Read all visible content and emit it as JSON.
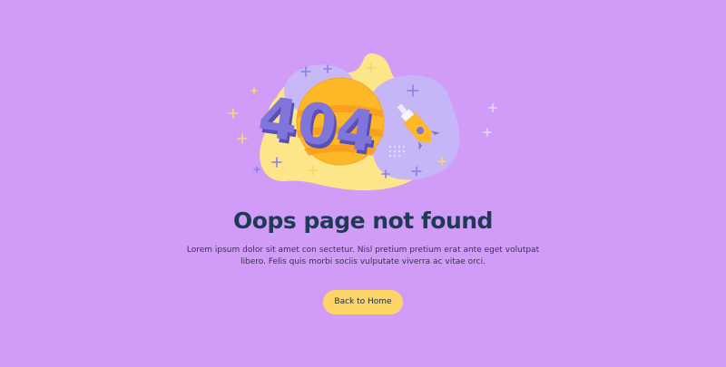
{
  "error": {
    "code_graphic": "404",
    "title": "Oops page not found",
    "description": "Lorem ipsum dolor sit amet con sectetur. Nisl pretium pretium erat ante eget volutpat libero. Felis quis morbi sociis vulputate viverra ac vitae orci.",
    "button_label": "Back to Home"
  },
  "icons": {
    "illustration": "404-planet-rocket-illustration",
    "rocket": "rocket-icon",
    "planet": "planet-icon",
    "sparkle": "plus-sparkle-icon"
  },
  "colors": {
    "background": "#d09cf7",
    "title": "#1d3b53",
    "button": "#fdd567",
    "planet": "#fcb827",
    "blob_yellow": "#fde68a",
    "blob_lavender": "#c7b8f7",
    "digits": "#7a6fd8"
  }
}
